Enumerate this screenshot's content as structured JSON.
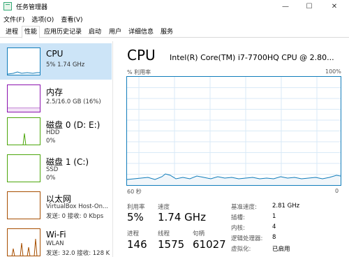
{
  "window": {
    "title": "任务管理器"
  },
  "menu": [
    "文件(F)",
    "选项(O)",
    "查看(V)"
  ],
  "tabs": [
    "进程",
    "性能",
    "应用历史记录",
    "启动",
    "用户",
    "详细信息",
    "服务"
  ],
  "sidebar": {
    "cpu": {
      "name": "CPU",
      "line1": "5% 1.74 GHz"
    },
    "mem": {
      "name": "内存",
      "line1": "2.5/16.0 GB (16%)"
    },
    "disk0": {
      "name": "磁盘 0 (D: E:)",
      "line1": "HDD",
      "line2": "0%"
    },
    "disk1": {
      "name": "磁盘 1 (C:)",
      "line1": "SSD",
      "line2": "0%"
    },
    "eth": {
      "name": "以太网",
      "line1": "VirtualBox Host-On...",
      "line2": "发送: 0 接收: 0 Kbps"
    },
    "wifi": {
      "name": "Wi-Fi",
      "line1": "WLAN",
      "line2": "发送: 32.0 接收: 128 K"
    }
  },
  "main": {
    "title": "CPU",
    "model": "Intel(R) Core(TM) i7-7700HQ CPU @ 2.80...",
    "util_label": "% 利用率",
    "util_max": "100%",
    "time_left": "60 秒",
    "time_right": "0",
    "stats": {
      "util_label": "利用率",
      "util_value": "5%",
      "speed_label": "速度",
      "speed_value": "1.74 GHz",
      "proc_label": "进程",
      "proc_value": "146",
      "thread_label": "线程",
      "thread_value": "1575",
      "handle_label": "句柄",
      "handle_value": "61027"
    },
    "details": [
      {
        "label": "基准速度:",
        "value": "2.81 GHz"
      },
      {
        "label": "插槽:",
        "value": "1"
      },
      {
        "label": "内核:",
        "value": "4"
      },
      {
        "label": "逻辑处理器:",
        "value": "8"
      },
      {
        "label": "虚拟化:",
        "value": "已启用"
      }
    ]
  },
  "colors": {
    "cpu": "#117dbb",
    "mem": "#8b12ae",
    "disk": "#4da60c",
    "net": "#a74f01",
    "selected": "#cce4f7"
  }
}
